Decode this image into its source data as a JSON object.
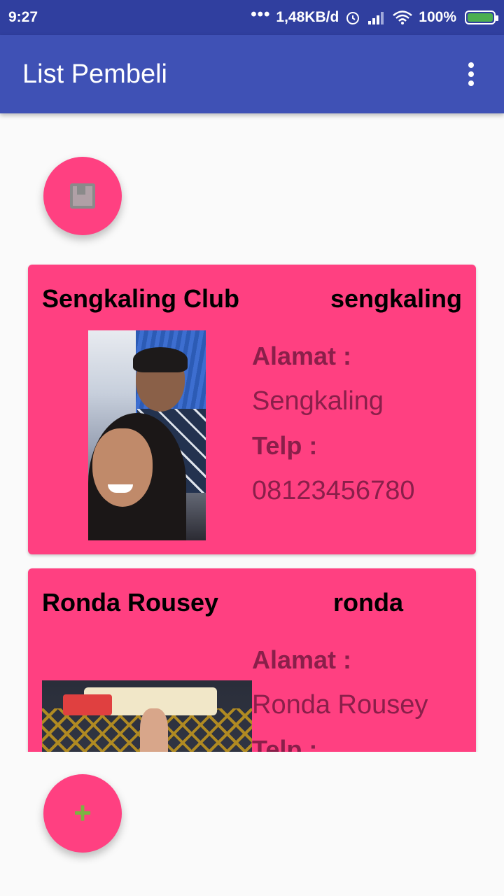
{
  "status_bar": {
    "time": "9:27",
    "dots": "•••",
    "network_speed": "1,48KB/d",
    "battery": "100%"
  },
  "app_bar": {
    "title": "List Pembeli",
    "overflow_icon": "more-vert-icon"
  },
  "fab_top": {
    "icon": "bookmark-icon"
  },
  "fab_bottom": {
    "icon": "plus-icon",
    "label": "+"
  },
  "cards": [
    {
      "name": "Sengkaling Club",
      "username": "sengkaling",
      "alamat_label": "Alamat :",
      "alamat": "Sengkaling",
      "telp_label": "Telp :",
      "telp": "08123456780"
    },
    {
      "name": "Ronda Rousey",
      "username": "ronda",
      "alamat_label": "Alamat :",
      "alamat": "Ronda Rousey",
      "telp_label": "Telp :"
    }
  ],
  "colors": {
    "status_bar": "#303f9f",
    "app_bar": "#3f51b5",
    "accent": "#ff4081",
    "detail_text": "#8a1f4a",
    "plus": "#7cb342"
  }
}
